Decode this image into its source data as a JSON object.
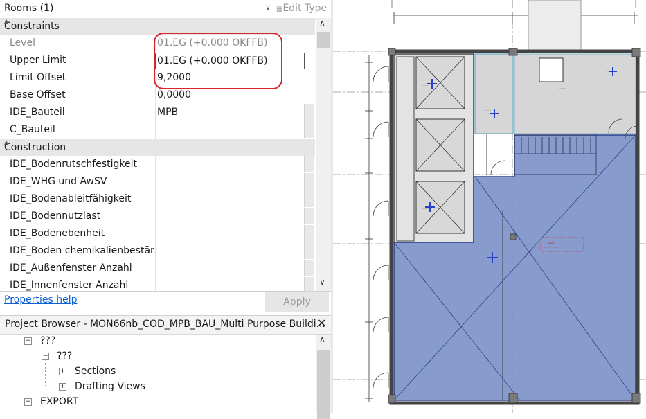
{
  "properties": {
    "type_selector": "Rooms (1)",
    "edit_type": "Edit Type",
    "categories": {
      "constraints": "Constraints",
      "construction": "Construction"
    },
    "rows": {
      "level": {
        "name": "Level",
        "value": "01.EG (+0.000 OKFFB)"
      },
      "upper_limit": {
        "name": "Upper Limit",
        "value": "01.EG (+0.000 OKFFB)"
      },
      "limit_offset": {
        "name": "Limit Offset",
        "value": "9,2000"
      },
      "base_offset": {
        "name": "Base Offset",
        "value": "0,0000"
      },
      "ide_bauteil": {
        "name": "IDE_Bauteil",
        "value": "MPB"
      },
      "c_bauteil": {
        "name": "C_Bauteil",
        "value": ""
      },
      "c1": {
        "name": "IDE_Bodenrutschfestigkeit",
        "value": ""
      },
      "c2": {
        "name": "IDE_WHG und AwSV",
        "value": ""
      },
      "c3": {
        "name": "IDE_Bodenableitfähigkeit",
        "value": ""
      },
      "c4": {
        "name": "IDE_Bodennutzlast",
        "value": ""
      },
      "c5": {
        "name": "IDE_Bodenebenheit",
        "value": ""
      },
      "c6": {
        "name": "IDE_Boden chemikalienbestän...",
        "value": ""
      },
      "c7": {
        "name": "IDE_Außenfenster Anzahl",
        "value": ""
      },
      "c8": {
        "name": "IDE_Innenfenster Anzahl",
        "value": ""
      }
    },
    "help_link": "Properties help",
    "apply": "Apply"
  },
  "project_browser": {
    "title": "Project Browser - MON66nb_COD_MPB_BAU_Multi Purpose Buildi...",
    "nodes": {
      "n1": "???",
      "n2": "???",
      "sections": "Sections",
      "drafting": "Drafting Views",
      "export": "EXPORT"
    }
  },
  "colors": {
    "highlight": "#d7262c",
    "room_fill": "#7d93c9",
    "link": "#0a5fd1"
  },
  "icons": [
    "chevron-down-icon",
    "edit-type-icon",
    "scroll-up-icon",
    "scroll-down-icon",
    "close-icon",
    "collapse-icon",
    "expand-icon",
    "room-tag-icon"
  ]
}
